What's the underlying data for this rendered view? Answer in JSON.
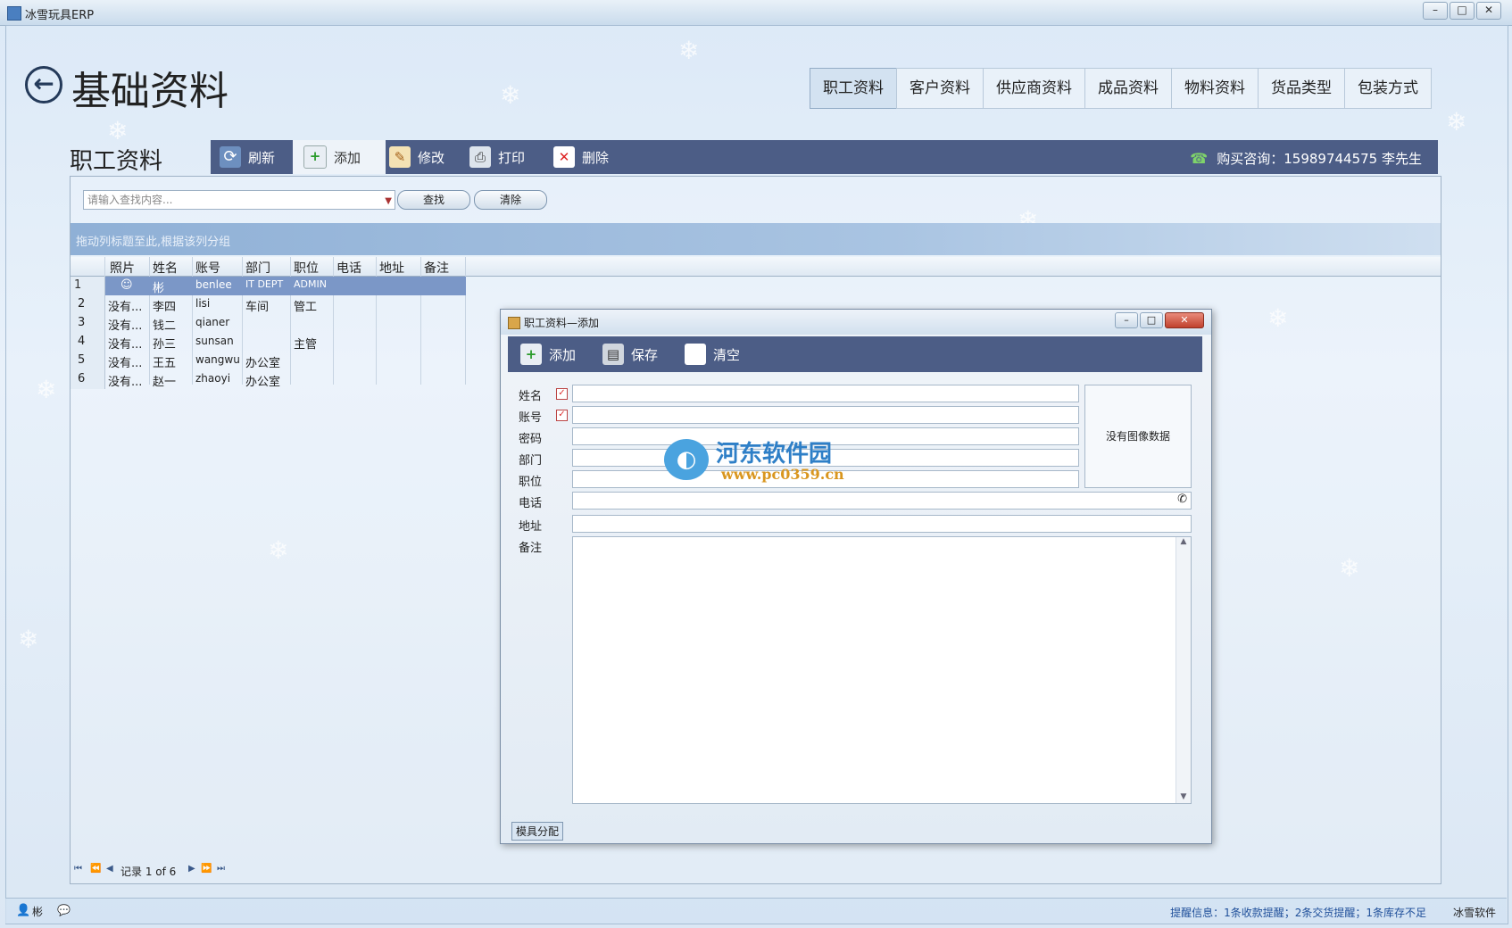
{
  "window": {
    "title": "冰雪玩具ERP"
  },
  "header": {
    "title": "基础资料"
  },
  "tabs": [
    "职工资料",
    "客户资料",
    "供应商资料",
    "成品资料",
    "物料资料",
    "货品类型",
    "包装方式"
  ],
  "section": {
    "title": "职工资料"
  },
  "toolbar": {
    "refresh": "刷新",
    "add": "添加",
    "edit": "修改",
    "print": "打印",
    "delete": "删除",
    "contact": "购买咨询：15989744575  李先生"
  },
  "search": {
    "placeholder": "请输入查找内容...",
    "find": "查找",
    "clear": "清除"
  },
  "group_hint": "拖动列标题至此,根据该列分组",
  "grid": {
    "columns": [
      "照片",
      "姓名",
      "账号",
      "部门",
      "职位",
      "电话",
      "地址",
      "备注"
    ],
    "rows": [
      {
        "n": "1",
        "photo": "",
        "name": "彬",
        "account": "benlee",
        "dept": "IT DEPT",
        "title": "ADMIN"
      },
      {
        "n": "2",
        "photo": "没有...",
        "name": "李四",
        "account": "lisi",
        "dept": "车间",
        "title": "管工"
      },
      {
        "n": "3",
        "photo": "没有...",
        "name": "钱二",
        "account": "qianer",
        "dept": "",
        "title": ""
      },
      {
        "n": "4",
        "photo": "没有...",
        "name": "孙三",
        "account": "sunsan",
        "dept": "",
        "title": "主管"
      },
      {
        "n": "5",
        "photo": "没有...",
        "name": "王五",
        "account": "wangwu",
        "dept": "办公室",
        "title": ""
      },
      {
        "n": "6",
        "photo": "没有...",
        "name": "赵一",
        "account": "zhaoyi",
        "dept": "办公室",
        "title": ""
      }
    ]
  },
  "pager": {
    "text": "记录 1 of 6"
  },
  "statusbar": {
    "user": "彬",
    "info": "提醒信息：1条收款提醒；2条交货提醒；1条库存不足",
    "brand": "冰雪软件"
  },
  "dialog": {
    "title": "职工资料—添加",
    "add": "添加",
    "save": "保存",
    "clear": "清空",
    "labels": {
      "name": "姓名",
      "account": "账号",
      "password": "密码",
      "dept": "部门",
      "position": "职位",
      "phone": "电话",
      "address": "地址",
      "memo": "备注"
    },
    "no_image": "没有图像数据",
    "tab": "模具分配"
  },
  "watermark": {
    "name": "河东软件园",
    "url": "www.pc0359.cn"
  }
}
